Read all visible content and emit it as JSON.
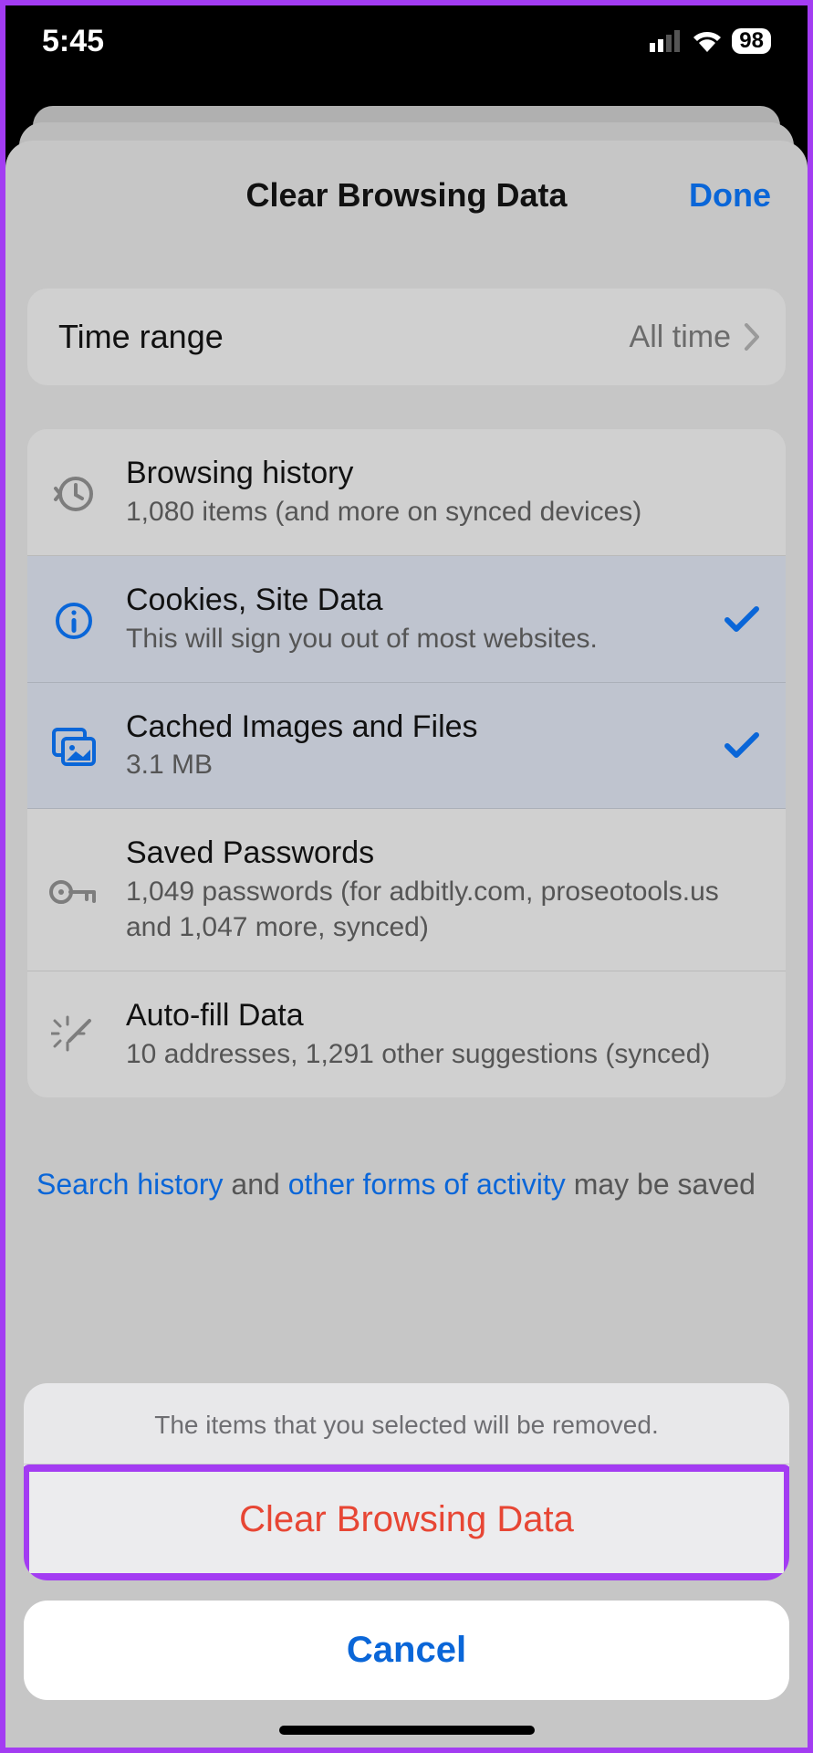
{
  "status": {
    "time": "5:45",
    "battery": "98"
  },
  "header": {
    "title": "Clear Browsing Data",
    "done": "Done"
  },
  "time_range": {
    "label": "Time range",
    "value": "All time"
  },
  "items": {
    "history": {
      "title": "Browsing history",
      "sub": "1,080 items (and more on synced devices)"
    },
    "cookies": {
      "title": "Cookies, Site Data",
      "sub": "This will sign you out of most websites."
    },
    "cache": {
      "title": "Cached Images and Files",
      "sub": "3.1 MB"
    },
    "passwords": {
      "title": "Saved Passwords",
      "sub": "1,049 passwords (for adbitly.com, proseotools.us and 1,047 more, synced)"
    },
    "autofill": {
      "title": "Auto-fill Data",
      "sub": "10 addresses, 1,291 other suggestions (synced)"
    }
  },
  "footer": {
    "link1": "Search history",
    "mid": " and ",
    "link2": "other forms of activity",
    "tail": " may be saved"
  },
  "action": {
    "message": "The items that you selected will be removed.",
    "destructive": "Clear Browsing Data",
    "cancel": "Cancel"
  }
}
